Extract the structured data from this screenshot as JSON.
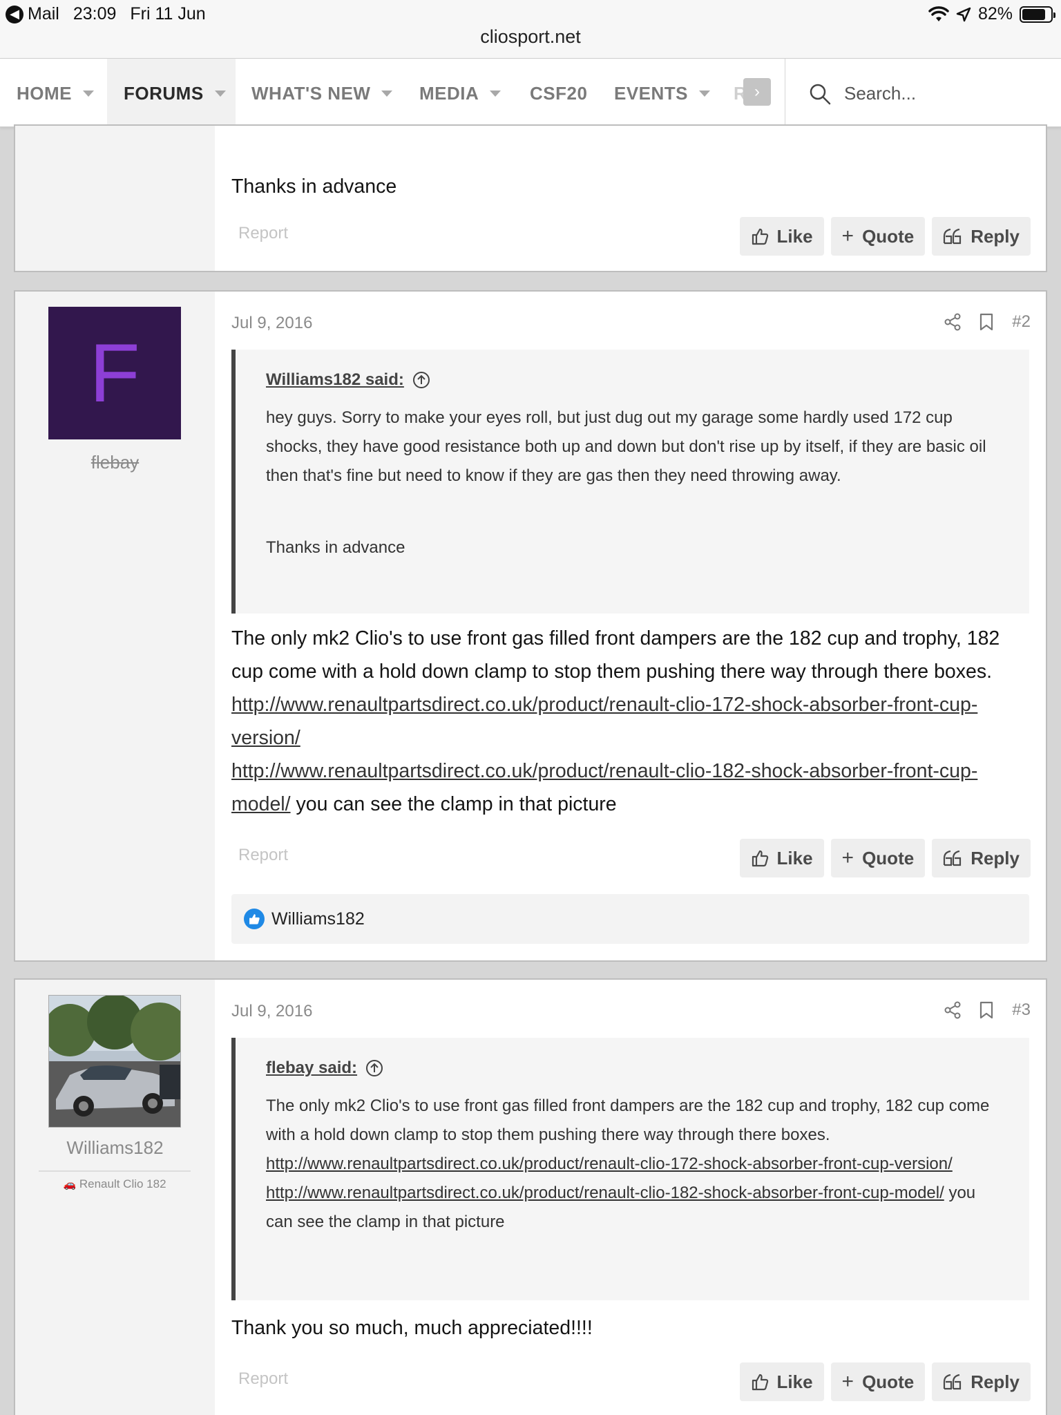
{
  "status_bar": {
    "back_app": "Mail",
    "time": "23:09",
    "date": "Fri 11 Jun",
    "battery": "82%",
    "url": "cliosport.net"
  },
  "nav": {
    "items": [
      {
        "label": "HOME",
        "has_caret": true
      },
      {
        "label": "FORUMS",
        "has_caret": true,
        "active": true
      },
      {
        "label": "WHAT'S NEW",
        "has_caret": true
      },
      {
        "label": "MEDIA",
        "has_caret": true
      },
      {
        "label": "CSF20",
        "has_caret": false
      },
      {
        "label": "EVENTS",
        "has_caret": true
      },
      {
        "label": "R"
      }
    ],
    "search_placeholder": "Search..."
  },
  "post1": {
    "body_tail": "Thanks in advance"
  },
  "post2": {
    "avatar_letter": "F",
    "username": "flebay",
    "date": "Jul 9, 2016",
    "number": "#2",
    "quote": {
      "author": "Williams182 said:",
      "text": "hey guys. Sorry to make your eyes roll, but just dug out my garage some hardly used 172 cup shocks, they have good resistance both up and down but don't rise up by itself, if they are basic oil then that's fine but need to know if they are gas then they need throwing away.",
      "text2": "Thanks in advance"
    },
    "body_text": "The only mk2 Clio's to use front gas filled front dampers are the 182 cup and trophy, 182 cup come with a hold down clamp to stop them pushing there way through there boxes.",
    "link1": "http://www.renaultpartsdirect.co.uk/product/renault-clio-172-shock-absorber-front-cup-version/",
    "link2": "http://www.renaultpartsdirect.co.uk/product/renault-clio-182-shock-absorber-front-cup-model/",
    "body_tail": " you can see the clamp in that picture",
    "reaction_user": "Williams182"
  },
  "post3": {
    "username": "Williams182",
    "user_title": "Renault Clio 182",
    "date": "Jul 9, 2016",
    "number": "#3",
    "quote": {
      "author": "flebay said:",
      "text": "The only mk2 Clio's to use front gas filled front dampers are the 182 cup and trophy, 182 cup come with a hold down clamp to stop them pushing there way through there boxes.",
      "link1": "http://www.renaultpartsdirect.co.uk/product/renault-clio-172-shock-absorber-front-cup-version/",
      "link2": "http://www.renaultpartsdirect.co.uk/product/renault-clio-182-shock-absorber-front-cup-model/",
      "tail": " you can see the clamp in that picture"
    },
    "body_text": "Thank you so much, much appreciated!!!!"
  },
  "actions": {
    "report": "Report",
    "like": "Like",
    "quote": "Quote",
    "reply": "Reply"
  },
  "colors": {
    "avatar_bg": "#32174d",
    "avatar_letter": "#8d3fd6",
    "like_badge": "#1f89e5"
  }
}
